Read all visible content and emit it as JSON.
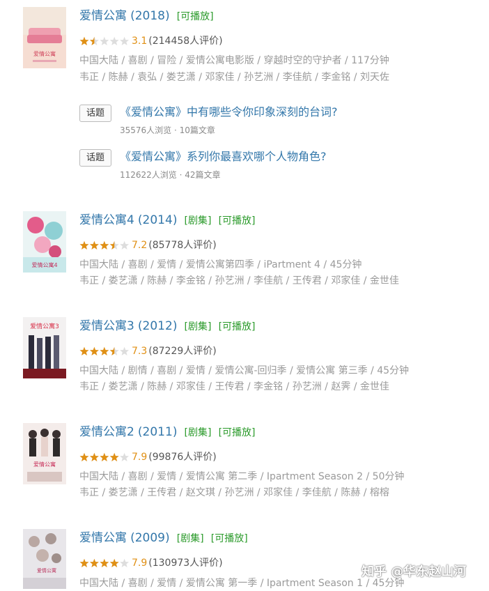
{
  "colors": {
    "link": "#3377aa",
    "playable": "#2a9a2a",
    "score": "#e09015",
    "meta": "#9a9a9a"
  },
  "items": [
    {
      "title": "爱情公寓",
      "year": "(2018)",
      "tags": [
        "[可播放]"
      ],
      "rating": 1.5,
      "score": "3.1",
      "count": "(214458人评价)",
      "meta": "中国大陆 / 喜剧 / 冒险 / 爱情公寓电影版 / 穿越时空的守护者 / 117分钟",
      "cast": "韦正 / 陈赫 / 袁弘 / 娄艺潇 / 邓家佳 / 孙艺洲 / 李佳航 / 李金铭 / 刘天佐"
    },
    {
      "title": "爱情公寓4",
      "year": "(2014)",
      "tags": [
        "[剧集]",
        "[可播放]"
      ],
      "rating": 3.5,
      "score": "7.2",
      "count": "(85778人评价)",
      "meta": "中国大陆 / 喜剧 / 爱情 / 爱情公寓第四季 / iPartment 4 / 45分钟",
      "cast": "韦正 / 娄艺潇 / 陈赫 / 李金铭 / 孙艺洲 / 李佳航 / 王传君 / 邓家佳 / 金世佳"
    },
    {
      "title": "爱情公寓3",
      "year": "(2012)",
      "tags": [
        "[剧集]",
        "[可播放]"
      ],
      "rating": 3.5,
      "score": "7.3",
      "count": "(87229人评价)",
      "meta": "中国大陆 / 剧情 / 喜剧 / 爱情 / 爱情公寓-回归季 / 爱情公寓 第三季 / 45分钟",
      "cast": "韦正 / 娄艺潇 / 陈赫 / 邓家佳 / 王传君 / 李金铭 / 孙艺洲 / 赵霁 / 金世佳"
    },
    {
      "title": "爱情公寓2",
      "year": "(2011)",
      "tags": [
        "[剧集]",
        "[可播放]"
      ],
      "rating": 4,
      "score": "7.9",
      "count": "(99876人评价)",
      "meta": "中国大陆 / 喜剧 / 爱情 / 爱情公寓 第二季 / Ipartment Season 2 / 50分钟",
      "cast": "韦正 / 娄艺潇 / 王传君 / 赵文琪 / 孙艺洲 / 邓家佳 / 李佳航 / 陈赫 / 榕榕"
    },
    {
      "title": "爱情公寓",
      "year": "(2009)",
      "tags": [
        "[剧集]",
        "[可播放]"
      ],
      "rating": 4,
      "score": "7.9",
      "count": "(130973人评价)",
      "meta": "中国大陆 / 喜剧 / 爱情 / 爱情公寓 第一季 / Ipartment Season 1 / 45分钟",
      "cast": ""
    }
  ],
  "topics": [
    {
      "badge": "话题",
      "title": "《爱情公寓》中有哪些令你印象深刻的台词?",
      "stats": "35576人浏览 · 10篇文章"
    },
    {
      "badge": "话题",
      "title": "《爱情公寓》系列你最喜欢哪个人物角色?",
      "stats": "112622人浏览 · 42篇文章"
    }
  ],
  "watermark": "知乎 @华东赵山河"
}
